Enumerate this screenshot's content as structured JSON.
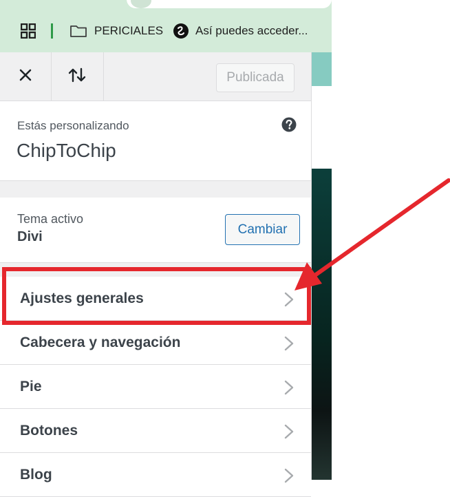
{
  "browser": {
    "bookmarks": [
      {
        "icon": "folder-icon",
        "label": "PERICIALES"
      },
      {
        "icon": "extension-icon",
        "label": "Así puedes acceder..."
      }
    ]
  },
  "header": {
    "publish_label": "Publicada"
  },
  "info": {
    "kicker": "Estás personalizando",
    "site_title": "ChipToChip"
  },
  "theme": {
    "kicker": "Tema activo",
    "name": "Divi",
    "change_label": "Cambiar"
  },
  "sections": [
    {
      "label": "Ajustes generales"
    },
    {
      "label": "Cabecera y navegación"
    },
    {
      "label": "Pie"
    },
    {
      "label": "Botones"
    },
    {
      "label": "Blog"
    }
  ],
  "colors": {
    "annotation_red": "#e5272d",
    "accent_blue": "#2271b1",
    "chrome_green": "#d3ebd9"
  }
}
